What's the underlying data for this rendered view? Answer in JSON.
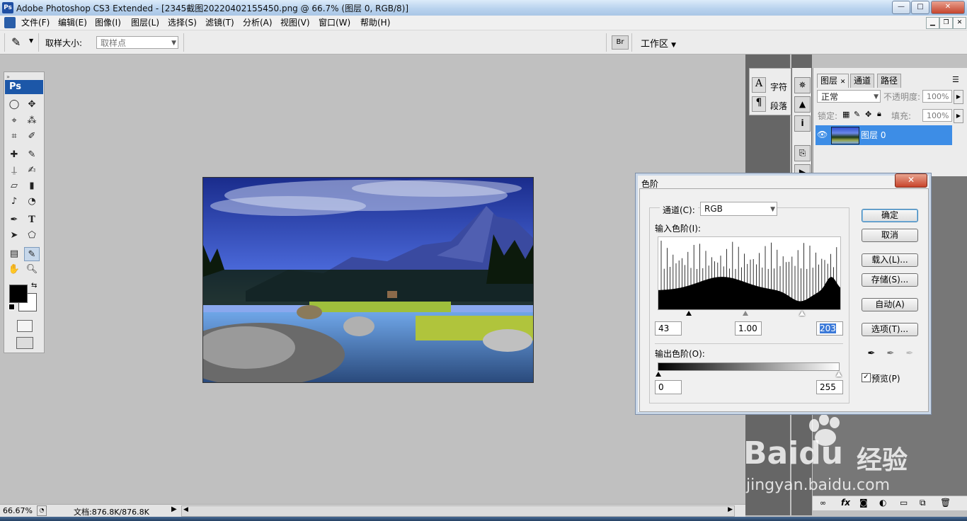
{
  "window": {
    "title": "Adobe Photoshop CS3 Extended - [2345截图20220402155450.png @ 66.7% (图层 0, RGB/8)]",
    "app_icon": "Ps",
    "buttons": {
      "minimize": "—",
      "maximize": "□",
      "close": "✕"
    }
  },
  "menubar": {
    "items": [
      "文件(F)",
      "编辑(E)",
      "图像(I)",
      "图层(L)",
      "选择(S)",
      "滤镜(T)",
      "分析(A)",
      "视图(V)",
      "窗口(W)",
      "帮助(H)"
    ]
  },
  "options_bar": {
    "sample_size_label": "取样大小:",
    "sample_size_value": "取样点",
    "workspace_label": "工作区"
  },
  "toolbox": {
    "header": "Ps"
  },
  "char_panel": {
    "character_label": "字符",
    "paragraph_label": "段落"
  },
  "layers_panel": {
    "tabs": [
      "图层",
      "通道",
      "路径"
    ],
    "blend_mode": "正常",
    "opacity_label": "不透明度:",
    "opacity_value": "100%",
    "lock_label": "锁定:",
    "fill_label": "填充:",
    "fill_value": "100%",
    "layer_name": "图层 0"
  },
  "status_bar": {
    "zoom": "66.67%",
    "doc_info": "文档:876.8K/876.8K"
  },
  "levels_dialog": {
    "title": "色阶",
    "channel_label": "通道(C):",
    "channel_value": "RGB",
    "input_levels_label": "输入色阶(I):",
    "input_black": "43",
    "input_gamma": "1.00",
    "input_white": "203",
    "output_levels_label": "输出色阶(O):",
    "output_black": "0",
    "output_white": "255",
    "buttons": {
      "ok": "确定",
      "cancel": "取消",
      "load": "载入(L)...",
      "save": "存储(S)...",
      "auto": "自动(A)",
      "options": "选项(T)..."
    },
    "preview_label": "预览(P)",
    "preview_checked": true
  },
  "watermark": {
    "brand": "Baidu",
    "brand_cn": "经验",
    "url": "jingyan.baidu.com"
  }
}
